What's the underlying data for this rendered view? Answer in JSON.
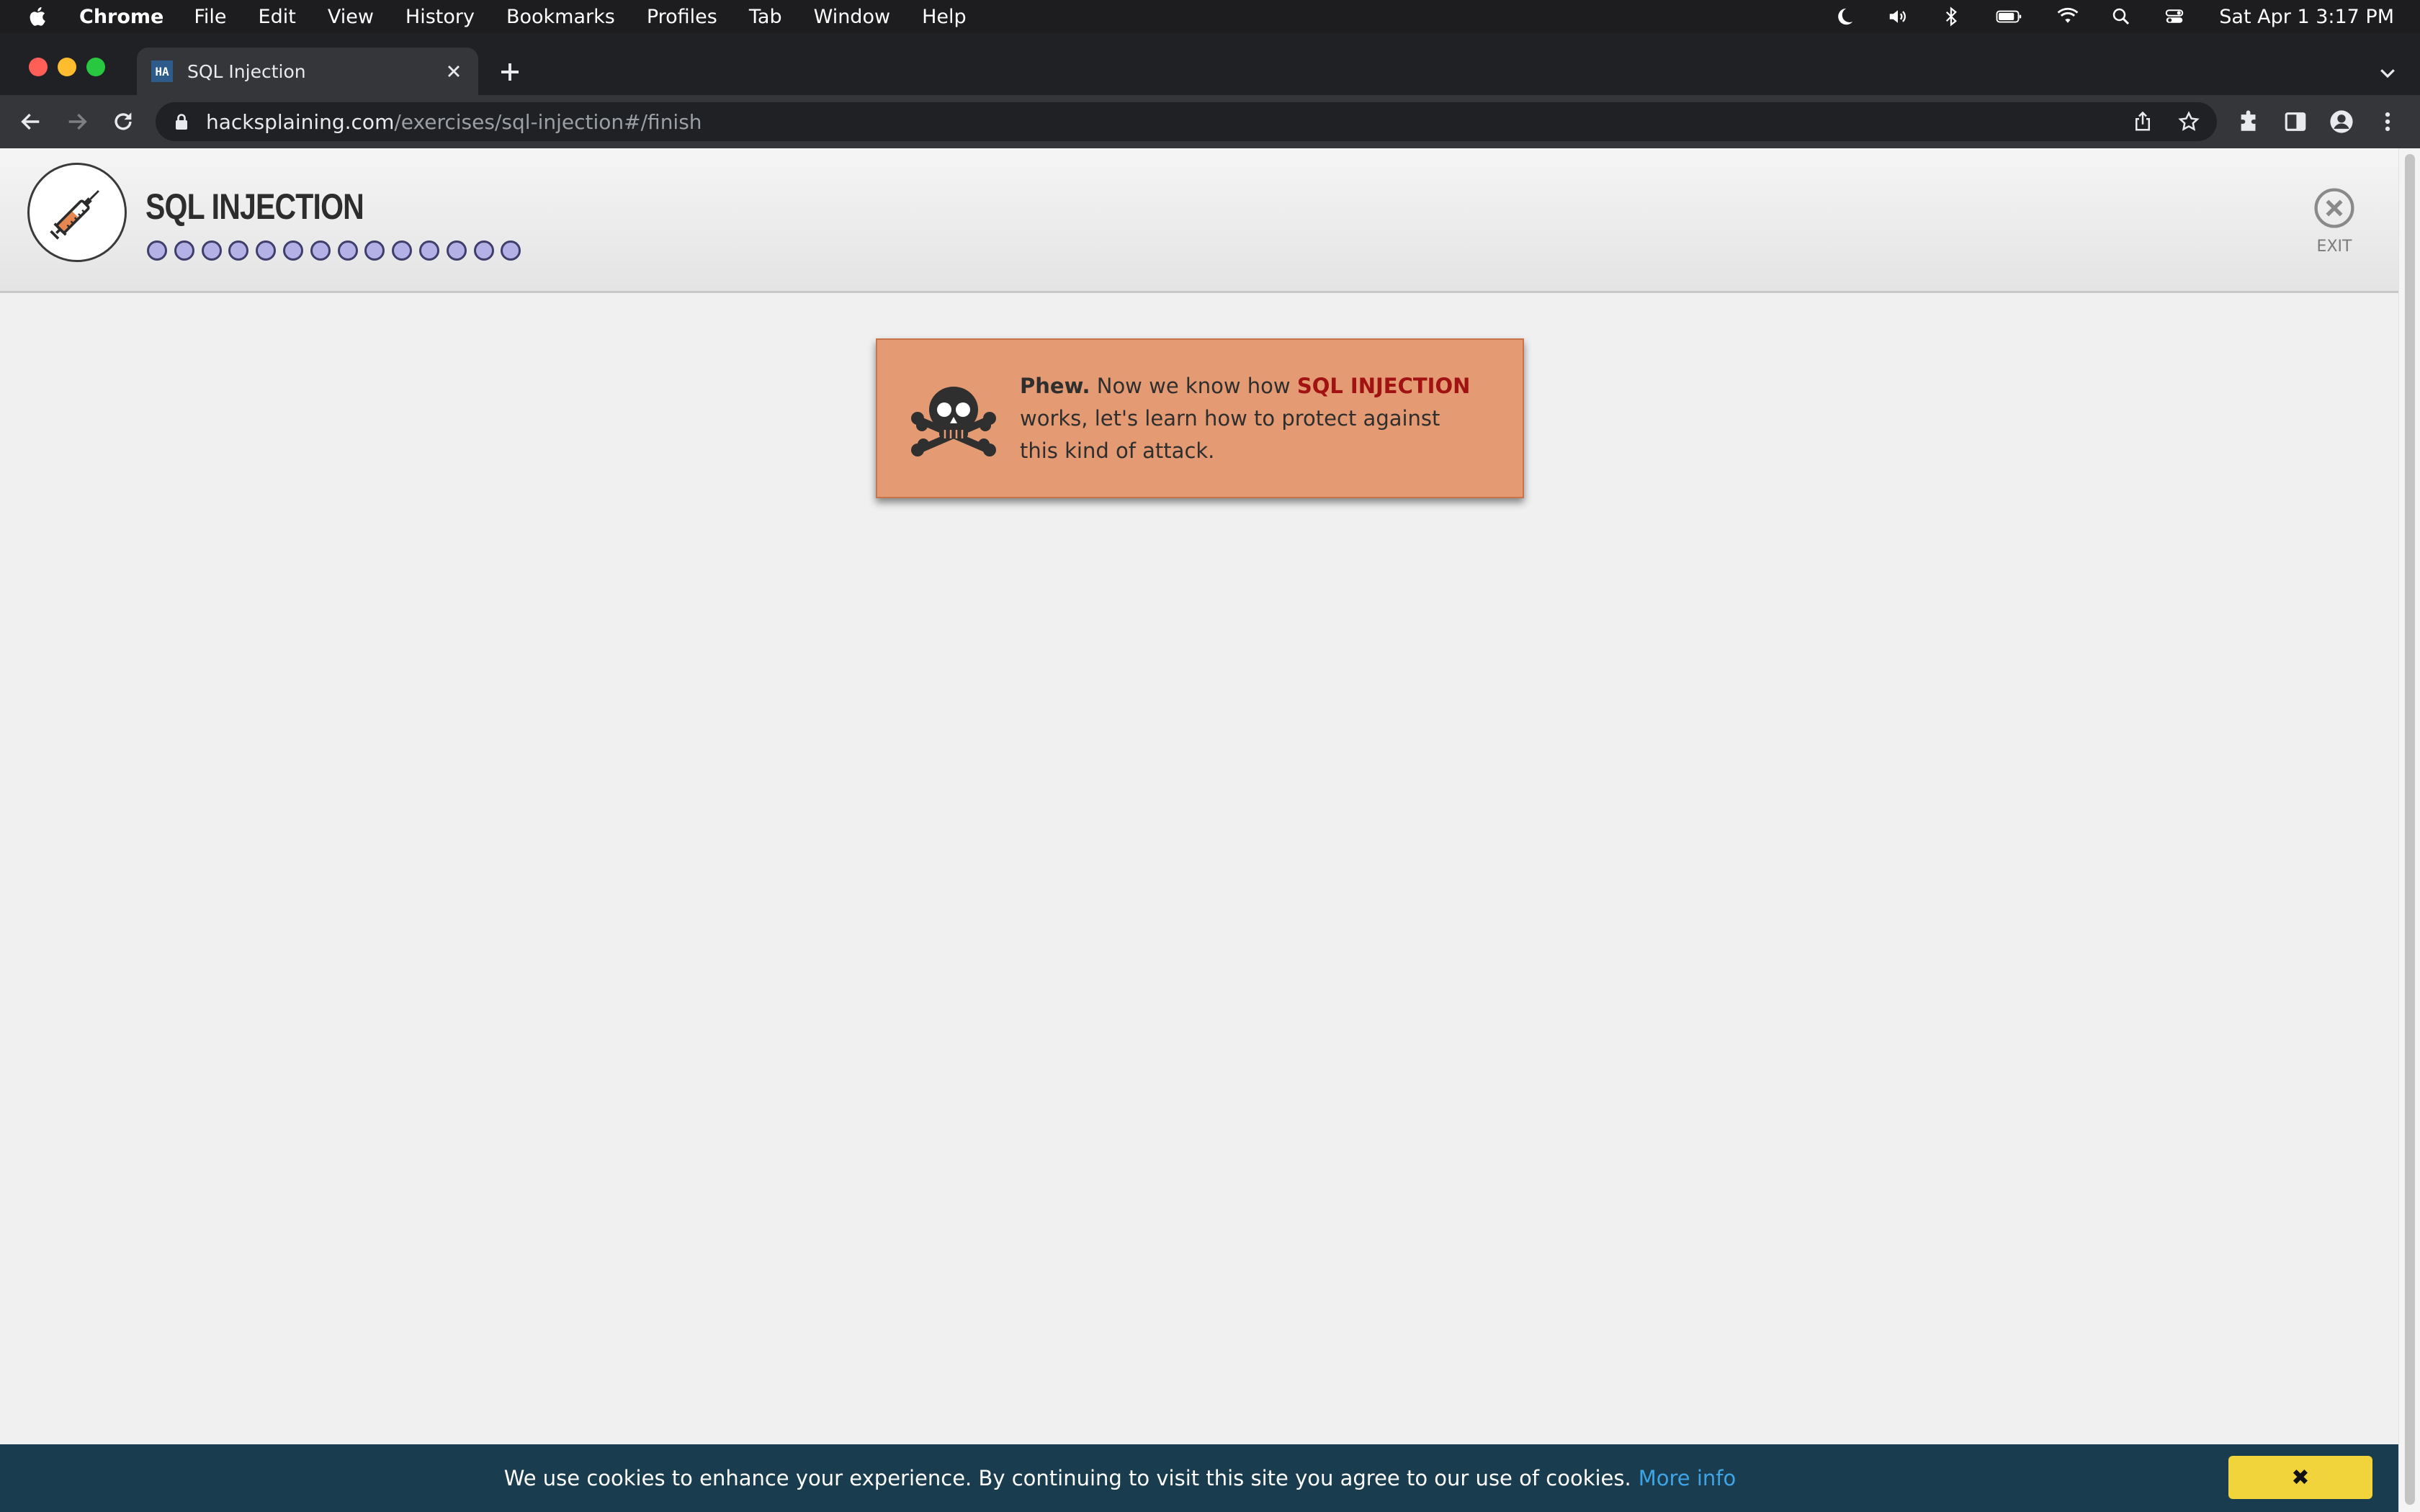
{
  "menubar": {
    "app": "Chrome",
    "items": [
      "File",
      "Edit",
      "View",
      "History",
      "Bookmarks",
      "Profiles",
      "Tab",
      "Window",
      "Help"
    ],
    "clock": "Sat Apr 1  3:17 PM"
  },
  "browser": {
    "tab_title": "SQL Injection",
    "favicon_text": "HA",
    "url_host": "hacksplaining.com",
    "url_path": "/exercises/sql-injection#/finish"
  },
  "lesson": {
    "title": "SQL INJECTION",
    "progress_steps": 14,
    "progress_completed": 14,
    "exit_label": "EXIT"
  },
  "notice": {
    "lead": "Phew.",
    "text_before": " Now we know how ",
    "highlight": "SQL INJECTION",
    "text_after": " works, let's learn how to protect against this kind of attack."
  },
  "cookie_banner": {
    "text": "We use cookies to enhance your experience. By continuing to visit this site you agree to our use of cookies.",
    "link": "More info",
    "close_symbol": "✖"
  }
}
